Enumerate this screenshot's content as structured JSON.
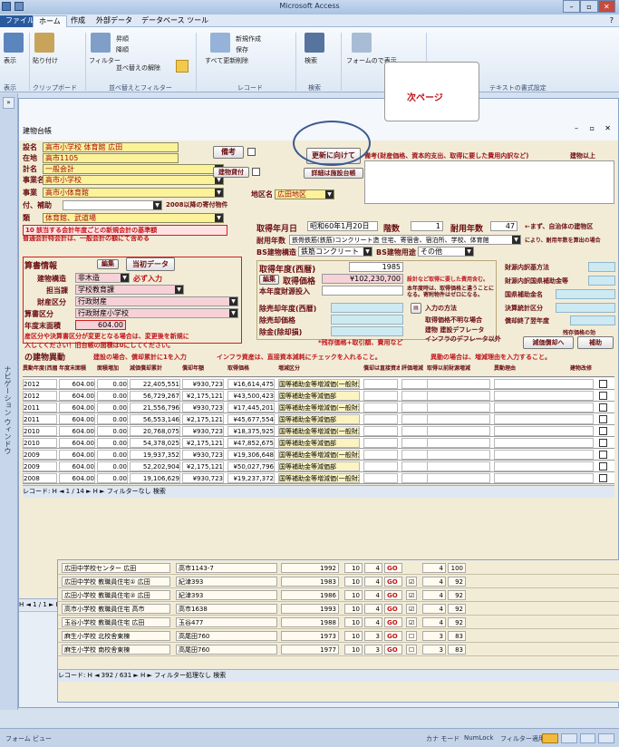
{
  "app": {
    "title": "Microsoft Access"
  },
  "ribbon": {
    "tabs": [
      "ファイル",
      "ホーム",
      "作成",
      "外部データ",
      "データベース ツール"
    ],
    "groups": [
      {
        "name": "表示",
        "buttons": [
          "表示"
        ]
      },
      {
        "name": "クリップボード",
        "buttons": [
          "貼り付け"
        ]
      },
      {
        "name": "並べ替えとフィルター",
        "buttons": [
          "フィルター",
          "昇順",
          "降順",
          "並べ替えの解除"
        ]
      },
      {
        "name": "レコード",
        "buttons": [
          "新規作成",
          "保存",
          "削除",
          "すべて更新"
        ]
      },
      {
        "name": "検索",
        "buttons": [
          "検索"
        ]
      },
      {
        "name": "",
        "buttons": [
          "フォームので表示"
        ]
      },
      {
        "name": "テキストの書式設定",
        "buttons": []
      }
    ]
  },
  "navpane": {
    "label": "ナビゲーション ウィンドウ"
  },
  "form": {
    "window_title": "建物台帳",
    "callout": "次ページ",
    "header_fields": [
      {
        "label": "設名",
        "value": "高市小学校 体育館 広田"
      },
      {
        "label": "在地",
        "value": "高市1105"
      },
      {
        "label": "計名",
        "value": "一般会計"
      },
      {
        "label": "事業名",
        "value": "高市小学校"
      },
      {
        "label": "事業",
        "value": "高市小体育館"
      },
      {
        "label": "付、補助",
        "value": ""
      },
      {
        "label": "類",
        "value": "体育館、武道場"
      }
    ],
    "buttons": {
      "bikou": "備考",
      "update": "更新に向けて",
      "kenbutsu": "建物貸付",
      "shousai": "詳細は施設台帳",
      "henshu": "編集",
      "touhoku": "当初データ",
      "henshu2": "編集",
      "input_method": "入力の方法",
      "genka": "減価償却へ",
      "hokan": "補助"
    },
    "notes": {
      "note10": "10 該当する会計年度ごとの新規会計の基準額",
      "note10b": "普通会計特会計は、一般会計の額にて含める",
      "y2008": "2008以降の寄付物件",
      "desc_head": "備考(財産価格、資本的支出、取得に要した費用内訳など)",
      "kenbutsu_ijou": "建物以上",
      "area": "地区名",
      "area_val": "広田地区",
      "shutoku_label": "取得年月日",
      "shutoku_val": "昭和60年1月20日",
      "kaisu_label": "階数",
      "kaisu_val": "1",
      "taiyo_label": "耐用年数",
      "taiyo_val": "47",
      "taiyo_note": "←まず、自治体の建物区",
      "taiyo_kouzou_label": "耐用年数",
      "taiyo_kouzou_val": "鉄骨鉄筋(鉄筋)コンクリート造 住宅、寄宿舎、宿泊所、学校、体育館",
      "taiyo_suffix": "により、耐用年数を算出の場合",
      "bs_kouzou_label": "BS建物構造",
      "bs_kouzou_val": "鉄筋コンクリート",
      "bs_youto_label": "BS建物用途",
      "bs_youto_val": "その他",
      "zaisan_title": "算書情報",
      "kouzou_label": "建物構造",
      "kouzou_val": "非木造",
      "kouzou_note": "必ず入力",
      "tantou_label": "担当課",
      "tantou_val": "学校教育課",
      "zaisan_kubun_label": "財産区分",
      "zaisan_kubun_val": "行政財産",
      "kessan_kubun_label": "算書区分",
      "kessan_kubun_val": "行政財産小学校",
      "area_label": "年度末面積",
      "area_val2": "604.00",
      "warn1": "産区分や決算書区分が変更となる場合は、変更後を新規に",
      "warn2": "入してください！旧台帳の面積は0にしてください。",
      "shutoku_nendo_label": "取得年度(西暦)",
      "shutoku_nendo_val": "1985",
      "shutoku_kakaku_label": "取得価格",
      "shutoku_kakaku_val": "¥102,230,700",
      "shutoku_kakaku_note": "設計など取得に要した費用含む。",
      "honnendo_label": "本年度財源投入",
      "honnendo_note": "本年度時は、取得価格と違うことになる。寄附物件はゼロになる。",
      "jokyaku_label": "除売却年度(西暦)",
      "jokyaku_kakaku_label": "除売却価格",
      "jokyaku_eki_label": "除金(除却損)",
      "zanson_note": "*残存価格+取引額、費用など",
      "shutoku_humei": "取得価格不明な場合",
      "kenbutsu_defl": "建物 建設デフレータ",
      "infura_defl": "インフラのデフレータ以外",
      "zaigen_label": "財源内訳基方法",
      "kokko_label": "財源内訳国県補助金等",
      "kokko_kyousei": "国県補助金名",
      "kessan_tou": "決算統計区分",
      "shoukyaku_label": "償却終了翌年度",
      "zanson_label": "残存価格の効",
      "banner1": "建設の場合、償却累計に1を入力",
      "banner2": "インフラ資産は、直接資本減耗にチェックを入れること。",
      "banner3": "異動の場合は、増減理由を入力すること。",
      "lower_title": "の建物異動"
    },
    "grid_headers": [
      "異動年度(西暦)",
      "年度末面積",
      "面積増加",
      "減価償却累計",
      "償却年額",
      "取得価格",
      "増減区分",
      "償却は直接資本減耗",
      "評価増減",
      "取得以前財源増減",
      "異動理由",
      "建物改修"
    ],
    "grid_rows": [
      {
        "year": "2012",
        "area": "604.00",
        "inc": "0.00",
        "ruikei": "22,405,551",
        "nengaku": "¥930,723",
        "kakaku": "¥16,614,475",
        "kubun": "国等補助金等増減価(一般財源)"
      },
      {
        "year": "2012",
        "area": "604.00",
        "inc": "0.00",
        "ruikei": "56,729,267",
        "nengaku": "¥2,175,121",
        "kakaku": "¥43,500,423",
        "kubun": "国等補助金等減価部"
      },
      {
        "year": "2011",
        "area": "604.00",
        "inc": "0.00",
        "ruikei": "21,556,796",
        "nengaku": "¥930,723",
        "kakaku": "¥17,445,201",
        "kubun": "国等補助金等増減価(一般財源)"
      },
      {
        "year": "2011",
        "area": "604.00",
        "inc": "0.00",
        "ruikei": "56,553,146",
        "nengaku": "¥2,175,121",
        "kakaku": "¥45,677,554",
        "kubun": "国等補助金等減価部"
      },
      {
        "year": "2010",
        "area": "604.00",
        "inc": "0.00",
        "ruikei": "20,768,075",
        "nengaku": "¥930,723",
        "kakaku": "¥18,375,925",
        "kubun": "国等補助金等増減価(一般財源)"
      },
      {
        "year": "2010",
        "area": "604.00",
        "inc": "0.00",
        "ruikei": "54,378,025",
        "nengaku": "¥2,175,121",
        "kakaku": "¥47,852,675",
        "kubun": "国等補助金等減価部"
      },
      {
        "year": "2009",
        "area": "604.00",
        "inc": "0.00",
        "ruikei": "19,937,352",
        "nengaku": "¥930,723",
        "kakaku": "¥19,306,648",
        "kubun": "国等補助金等増減価(一般財源)"
      },
      {
        "year": "2009",
        "area": "604.00",
        "inc": "0.00",
        "ruikei": "52,202,904",
        "nengaku": "¥2,175,121",
        "kakaku": "¥50,027,796",
        "kubun": "国等補助金等減価部"
      },
      {
        "year": "2008",
        "area": "604.00",
        "inc": "0.00",
        "ruikei": "19,106,629",
        "nengaku": "¥930,723",
        "kakaku": "¥19,237,372",
        "kubun": "国等補助金等増減価(一般財源)"
      }
    ],
    "grid_nav": "レコード: H ◄ 1 / 14 ► H ►  フィルターなし  検索",
    "form_nav": "H ◄ 1 / 1   ► H ►   フィルター適用   検索"
  },
  "list2": {
    "rows": [
      {
        "name": "広田中学校 教職員住宅① 広田",
        "addr": "紀津393",
        "year": "1983",
        "a": "10",
        "b": "4",
        "go": "GO",
        "chk": true,
        "c": "4",
        "d": "92"
      },
      {
        "name": "広田小学校 教職員住宅② 広田",
        "addr": "紀津393",
        "year": "1986",
        "a": "10",
        "b": "4",
        "go": "GO",
        "chk": true,
        "c": "4",
        "d": "92"
      },
      {
        "name": "高市小学校 教職員住宅 高市",
        "addr": "高市1638",
        "year": "1993",
        "a": "10",
        "b": "4",
        "go": "GO",
        "chk": true,
        "c": "4",
        "d": "92"
      },
      {
        "name": "玉谷小学校 教職員住宅 広田",
        "addr": "玉谷477",
        "year": "1988",
        "a": "10",
        "b": "4",
        "go": "GO",
        "chk": true,
        "c": "4",
        "d": "92"
      },
      {
        "name": "麻生小学校 北校舎東棟",
        "addr": "高尾田760",
        "year": "1973",
        "a": "10",
        "b": "3",
        "go": "GO",
        "chk": false,
        "c": "3",
        "d": "83"
      },
      {
        "name": "麻生小学校 南校舎東棟",
        "addr": "高尾田760",
        "year": "1977",
        "a": "10",
        "b": "3",
        "go": "GO",
        "chk": false,
        "c": "3",
        "d": "83"
      }
    ],
    "top_row": {
      "name": "広田中学校センター 広田",
      "addr": "高市1143-7",
      "year": "1992",
      "a": "10",
      "b": "4",
      "go": "GO",
      "c": "4",
      "d": "100"
    },
    "nav": "レコード: H ◄ 392 / 631 ► H ►  フィルター処理なし  検索"
  },
  "status": {
    "left": "フォーム ビュー",
    "mode": "カナ モード",
    "numlock": "NumLock",
    "filter": "フィルター適用"
  }
}
